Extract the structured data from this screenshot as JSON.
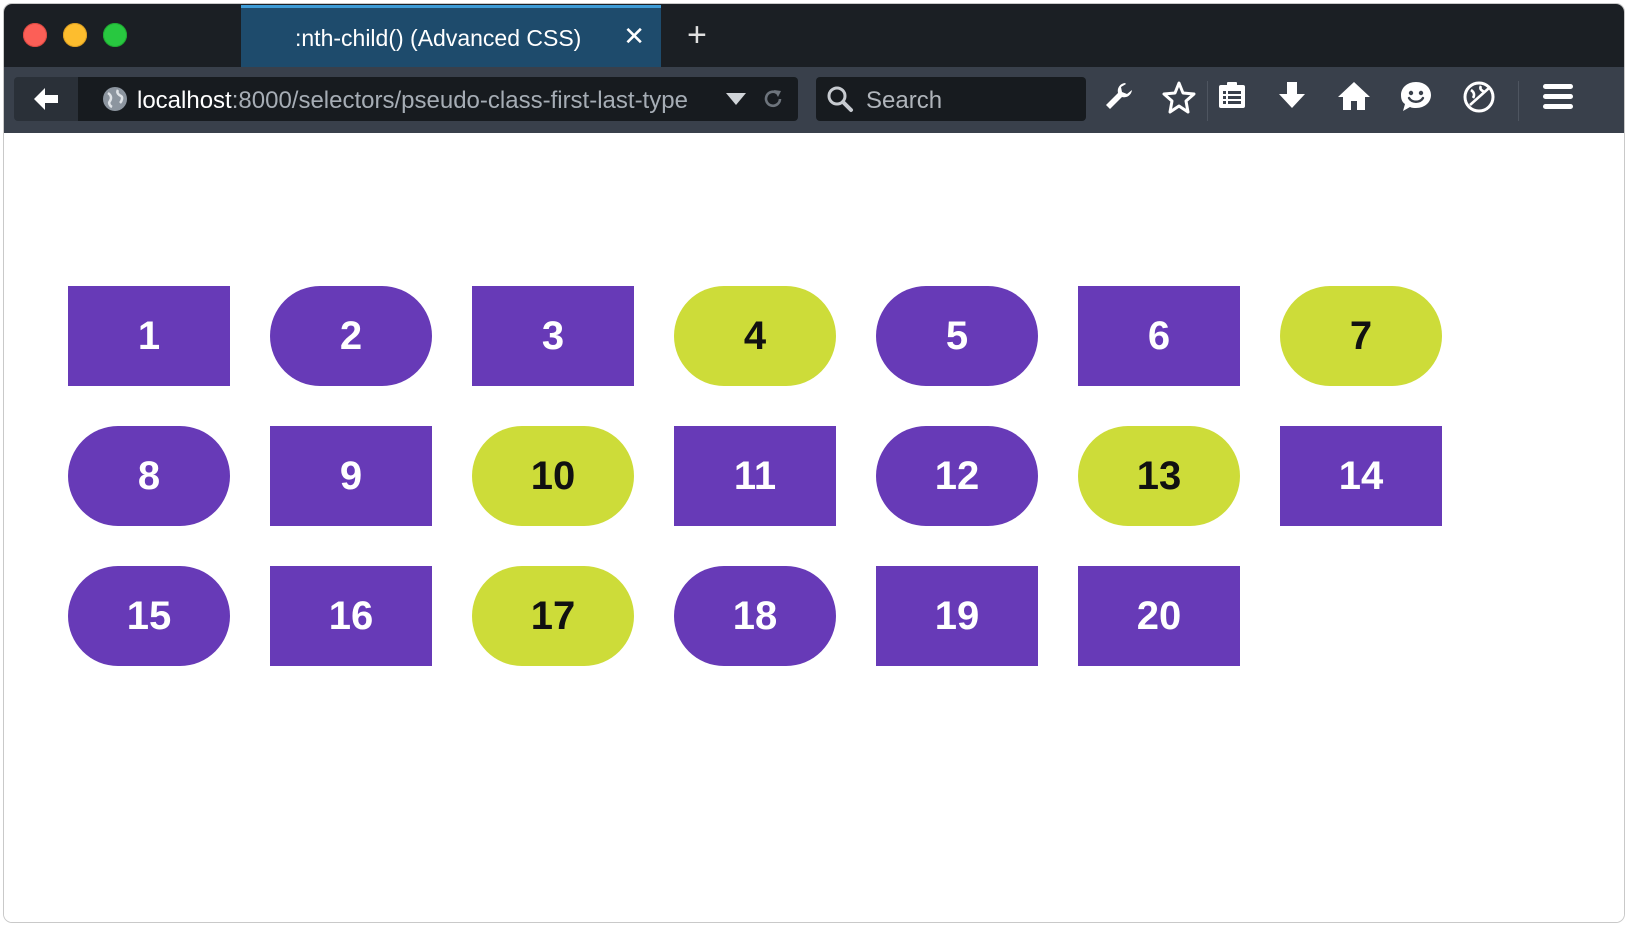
{
  "window": {
    "controls": [
      "close",
      "minimize",
      "maximize"
    ]
  },
  "tab": {
    "title": ":nth-child() (Advanced CSS)",
    "close_glyph": "✕",
    "new_tab_glyph": "+"
  },
  "navbar": {
    "url_host": "localhost",
    "url_path": ":8000/selectors/pseudo-class-first-last-type",
    "search_placeholder": "Search",
    "toolbar_icons": [
      "wrench-icon",
      "star-icon",
      "reading-list-icon",
      "download-icon",
      "home-icon",
      "chat-icon",
      "tracking-icon",
      "menu-icon"
    ]
  },
  "colors": {
    "purple": "#673ab7",
    "lime": "#cddc39",
    "tab_active": "#1e4b6c",
    "chrome_dark": "#1b1f24",
    "navbar": "#39404b"
  },
  "boxes": [
    {
      "label": "1",
      "shape": "rect",
      "color": "purple"
    },
    {
      "label": "2",
      "shape": "pill",
      "color": "purple"
    },
    {
      "label": "3",
      "shape": "rect",
      "color": "purple"
    },
    {
      "label": "4",
      "shape": "pill",
      "color": "lime"
    },
    {
      "label": "5",
      "shape": "pill",
      "color": "purple"
    },
    {
      "label": "6",
      "shape": "rect",
      "color": "purple"
    },
    {
      "label": "7",
      "shape": "pill",
      "color": "lime"
    },
    {
      "label": "8",
      "shape": "pill",
      "color": "purple"
    },
    {
      "label": "9",
      "shape": "rect",
      "color": "purple"
    },
    {
      "label": "10",
      "shape": "pill",
      "color": "lime"
    },
    {
      "label": "11",
      "shape": "rect",
      "color": "purple"
    },
    {
      "label": "12",
      "shape": "pill",
      "color": "purple"
    },
    {
      "label": "13",
      "shape": "pill",
      "color": "lime"
    },
    {
      "label": "14",
      "shape": "rect",
      "color": "purple"
    },
    {
      "label": "15",
      "shape": "pill",
      "color": "purple"
    },
    {
      "label": "16",
      "shape": "rect",
      "color": "purple"
    },
    {
      "label": "17",
      "shape": "pill",
      "color": "lime"
    },
    {
      "label": "18",
      "shape": "pill",
      "color": "purple"
    },
    {
      "label": "19",
      "shape": "rect",
      "color": "purple"
    },
    {
      "label": "20",
      "shape": "rect",
      "color": "purple"
    }
  ]
}
